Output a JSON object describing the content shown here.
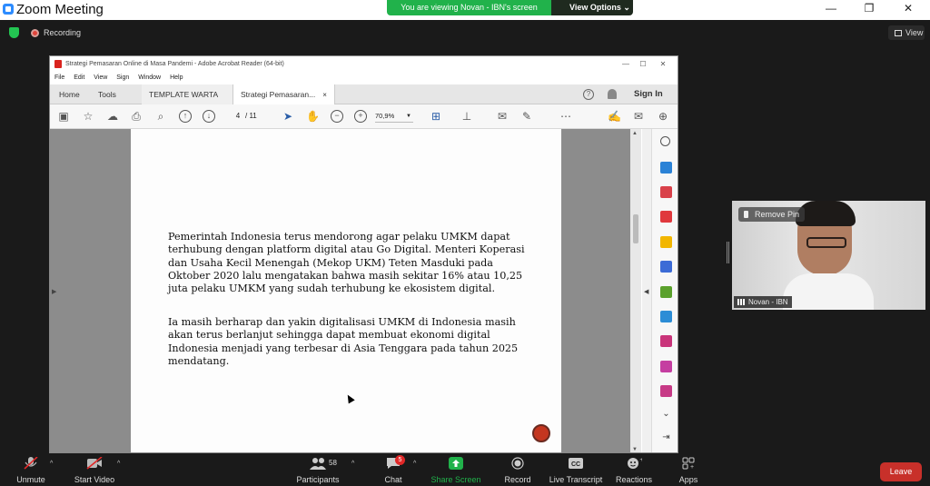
{
  "zoom": {
    "title": "Zoom Meeting",
    "share_banner": "You are viewing Novan - IBN's screen",
    "view_options": "View Options",
    "recording_label": "Recording",
    "view_label": "View",
    "win_min": "—",
    "win_restore": "❐",
    "win_close": "✕"
  },
  "acrobat": {
    "title": "Strategi Pemasaran Online di Masa Pandemi - Adobe Acrobat Reader (64-bit)",
    "menu": [
      "File",
      "Edit",
      "View",
      "Sign",
      "Window",
      "Help"
    ],
    "tabs": {
      "home": "Home",
      "tools": "Tools",
      "doc1": "TEMPLATE WARTA ...",
      "doc2": "Strategi Pemasaran...",
      "close": "×"
    },
    "sign_in": "Sign In",
    "current_page": "4",
    "total_pages": "/ 11",
    "zoom": "70,9%"
  },
  "document": {
    "paragraph1": "Pemerintah Indonesia terus mendorong agar pelaku UMKM dapat terhubung dengan platform digital atau Go Digital. Menteri Koperasi dan Usaha Kecil Menengah (Mekop UKM) Teten Masduki pada Oktober 2020 lalu mengatakan bahwa masih sekitar 16% atau 10,25 juta pelaku UMKM yang sudah terhubung ke ekosistem digital.",
    "paragraph2": "Ia masih berharap dan yakin digitalisasi UMKM di Indonesia masih akan terus berlanjut sehingga dapat membuat ekonomi digital Indonesia menjadi yang terbesar di Asia Tenggara pada tahun 2025 mendatang."
  },
  "participant": {
    "name": "Novan - IBN",
    "remove_pin": "Remove Pin"
  },
  "bottom_bar": {
    "unmute": "Unmute",
    "start_video": "Start Video",
    "participants": "Participants",
    "participants_count": "58",
    "chat": "Chat",
    "chat_badge": "5",
    "share_screen": "Share Screen",
    "record": "Record",
    "live_transcript": "Live Transcript",
    "reactions": "Reactions",
    "apps": "Apps",
    "leave": "Leave"
  },
  "colors": {
    "share_green": "#21b24b",
    "leave_red": "#c8302a",
    "acrobat_red": "#d9231e",
    "zoom_blue": "#2d8cff"
  }
}
